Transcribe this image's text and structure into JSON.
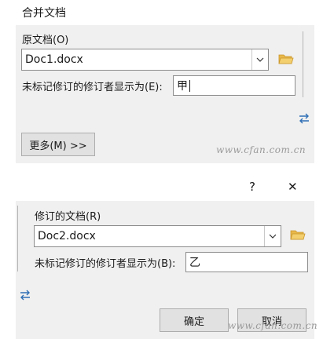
{
  "top": {
    "title": "合并文档",
    "source_label": "原文档(O)",
    "source_value": "Doc1.docx",
    "mark_label": "未标记修订的修订者显示为(E):",
    "mark_value": "甲",
    "more_button": "更多(M) >>",
    "watermark": "www.cfan.com.cn"
  },
  "bottom": {
    "help": "?",
    "close": "✕",
    "revised_label": "修订的文档(R)",
    "revised_value": "Doc2.docx",
    "mark_label": "未标记修订的修订者显示为(B):",
    "mark_value": "乙",
    "ok_button": "确定",
    "cancel_button": "取消",
    "watermark": "www.cfan.com.cn"
  },
  "icons": {
    "folder": "folder-icon",
    "swap": "swap-icon",
    "dropdown": "chevron-down-icon"
  },
  "colors": {
    "panel_bg": "#f0f0f0",
    "folder": "#e8b84a",
    "swap": "#2f6fb5"
  }
}
